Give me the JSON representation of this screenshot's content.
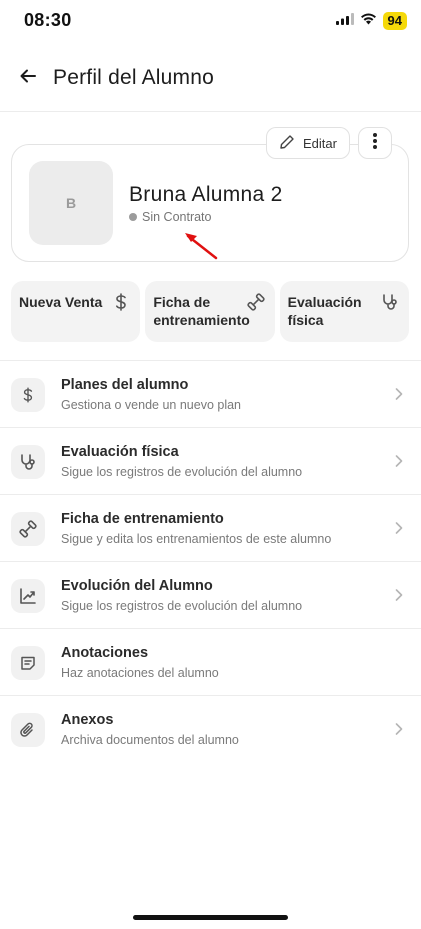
{
  "status_bar": {
    "time": "08:30",
    "battery": "94",
    "icons": [
      "cellular-signal-icon",
      "wifi-icon",
      "battery-icon"
    ]
  },
  "header": {
    "title": "Perfil del Alumno",
    "back_icon": "arrow-left-icon"
  },
  "profile": {
    "avatar_initial": "B",
    "name": "Bruna Alumna 2",
    "contract_status": "Sin Contrato",
    "edit_label": "Editar",
    "edit_icon": "pencil-icon",
    "more_icon": "more-vertical-icon"
  },
  "quick_actions": [
    {
      "label": "Nueva Venta",
      "icon": "dollar-icon"
    },
    {
      "label": "Ficha de entrenamiento",
      "icon": "dumbbell-icon"
    },
    {
      "label": "Evaluación física",
      "icon": "stethoscope-icon"
    }
  ],
  "menu": [
    {
      "title": "Planes del alumno",
      "subtitle": "Gestiona o vende un nuevo plan",
      "icon": "dollar-icon",
      "chevron": true
    },
    {
      "title": "Evaluación física",
      "subtitle": "Sigue los registros de evolución del alumno",
      "icon": "stethoscope-icon",
      "chevron": true
    },
    {
      "title": "Ficha de entrenamiento",
      "subtitle": "Sigue y edita los entrenamientos de este alumno",
      "icon": "dumbbell-icon",
      "chevron": true
    },
    {
      "title": "Evolución del Alumno",
      "subtitle": "Sigue los registros de evolución del alumno",
      "icon": "trending-up-icon",
      "chevron": true
    },
    {
      "title": "Anotaciones",
      "subtitle": "Haz anotaciones del alumno",
      "icon": "note-icon",
      "chevron": false
    },
    {
      "title": "Anexos",
      "subtitle": "Archiva documentos del alumno",
      "icon": "paperclip-icon",
      "chevron": true
    }
  ],
  "colors": {
    "battery": "#f5d90a",
    "annotation_arrow": "#e01010",
    "card_background": "#f3f3f3",
    "status_dot": "#9b9b9b"
  }
}
